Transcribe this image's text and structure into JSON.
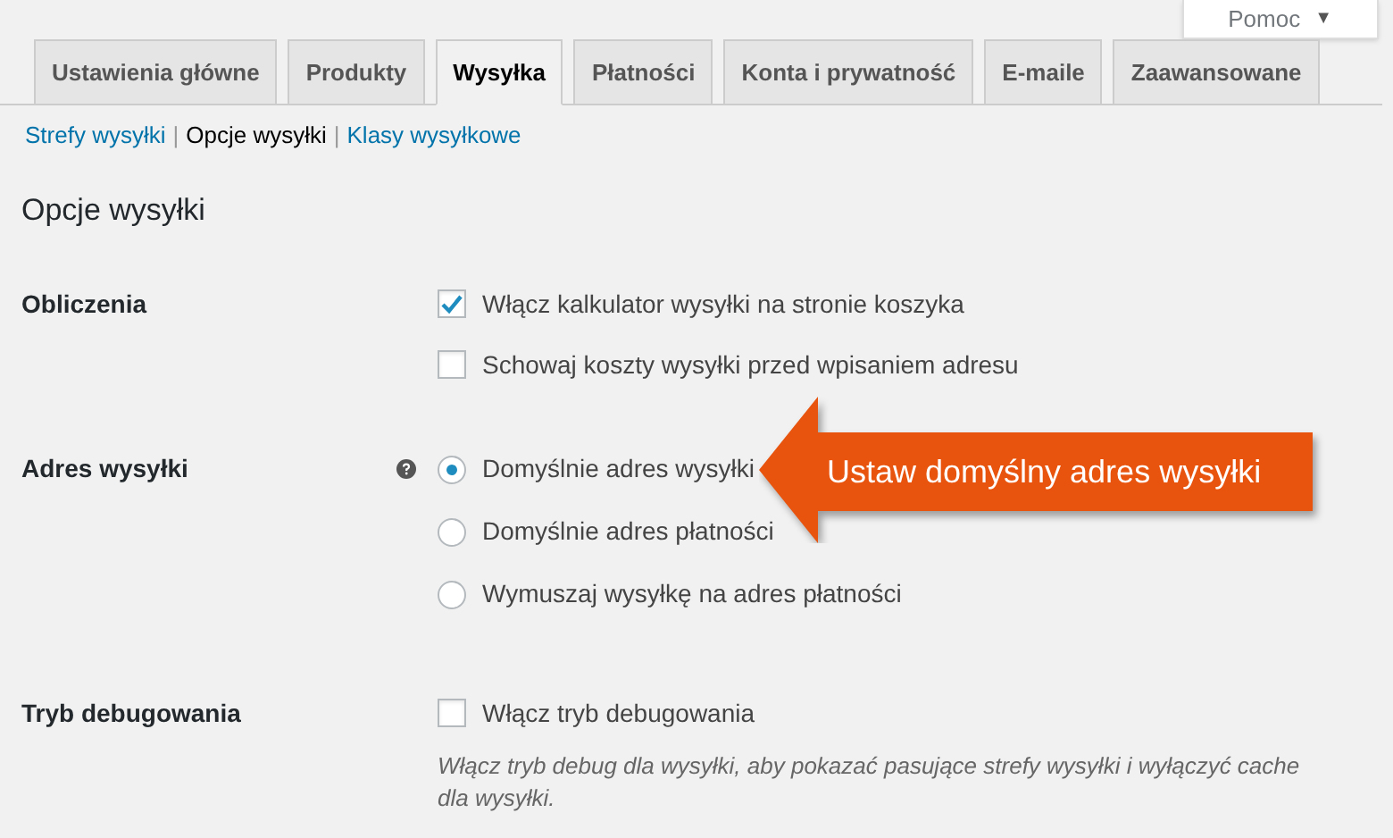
{
  "help_button": {
    "label": "Pomoc",
    "caret": "▼"
  },
  "tabs": [
    {
      "label": "Ustawienia główne",
      "selected": false
    },
    {
      "label": "Produkty",
      "selected": false
    },
    {
      "label": "Wysyłka",
      "selected": true
    },
    {
      "label": "Płatności",
      "selected": false
    },
    {
      "label": "Konta i prywatność",
      "selected": false
    },
    {
      "label": "E-maile",
      "selected": false
    },
    {
      "label": "Zaawansowane",
      "selected": false
    }
  ],
  "subnav": [
    {
      "label": "Strefy wysyłki",
      "selected": false
    },
    {
      "separator": "|",
      "label": "Opcje wysyłki",
      "selected": true
    },
    {
      "separator": "|",
      "label": "Klasy wysyłkowe",
      "selected": false
    }
  ],
  "section_title": "Opcje wysyłki",
  "settings": [
    {
      "label": "Obliczenia",
      "help": false,
      "options": [
        {
          "kind": "checkbox",
          "label": "Włącz kalkulator wysyłki na stronie koszyka",
          "checked": true
        },
        {
          "kind": "checkbox",
          "label": "Schowaj koszty wysyłki przed wpisaniem adresu",
          "checked": false
        }
      ]
    },
    {
      "label": "Adres wysyłki",
      "help": true,
      "options": [
        {
          "kind": "radio",
          "label": "Domyślnie adres wysyłki",
          "selected": true
        },
        {
          "kind": "radio",
          "label": "Domyślnie adres płatności",
          "selected": false
        },
        {
          "kind": "radio",
          "label": "Wymuszaj wysyłkę na adres płatności",
          "selected": false
        }
      ]
    },
    {
      "label": "Tryb debugowania",
      "help": false,
      "options": [
        {
          "kind": "checkbox",
          "label": "Włącz tryb debugowania",
          "checked": false
        }
      ],
      "description": "Włącz tryb debug dla wysyłki, aby pokazać pasujące strefy wysyłki i wyłączyć cache dla wysyłki."
    }
  ],
  "callout": "Ustaw domyślny adres wysyłki"
}
